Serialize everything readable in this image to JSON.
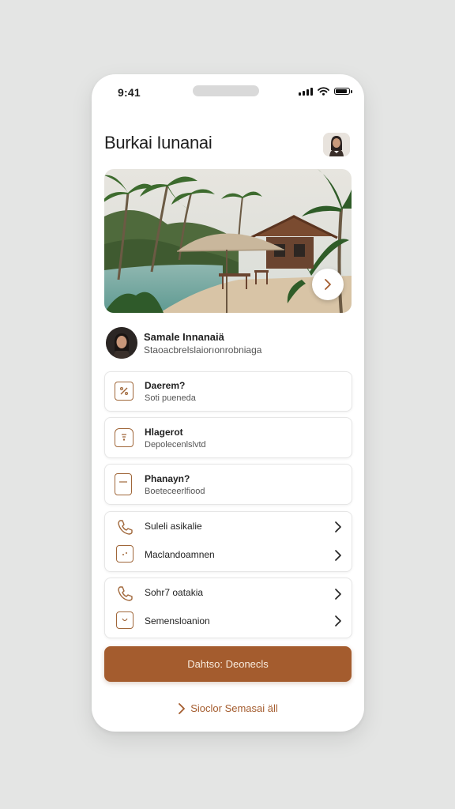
{
  "status_bar": {
    "time": "9:41"
  },
  "header": {
    "title": "Burkai Iunanai",
    "avatar_icon": "user-avatar"
  },
  "hero": {
    "next_icon": "chevron-right-icon"
  },
  "profile": {
    "name": "Samale Innanaiä",
    "subtitle": "Staoacbrelslaiorıonrobniaga"
  },
  "cards": [
    {
      "title": "Daerem?",
      "subtitle": "Soti pueneda",
      "icon": "tag-icon"
    },
    {
      "title": "Hlagerot",
      "subtitle": "Depolecenlslvtd",
      "icon": "jar-icon"
    },
    {
      "title": "Phanayn?",
      "subtitle": "Boeteceerlfiood",
      "icon": "document-icon"
    }
  ],
  "list_group_1": [
    {
      "label": "Suleli asikalie",
      "icon": "phone-icon"
    },
    {
      "label": "Maclandoamnen",
      "icon": "square-dots-icon"
    }
  ],
  "list_group_2": [
    {
      "label": "Sohr7 oatakia",
      "icon": "phone-icon"
    },
    {
      "label": "Semensloanion",
      "icon": "cup-icon"
    }
  ],
  "cta": {
    "label": "Dahtso: Deonecls"
  },
  "footer": {
    "label": "Sioclor Semasai äll",
    "icon": "chevron-right-icon"
  },
  "colors": {
    "accent": "#a45c2e",
    "background": "#e4e5e4",
    "card_border": "#e6e6e6"
  }
}
